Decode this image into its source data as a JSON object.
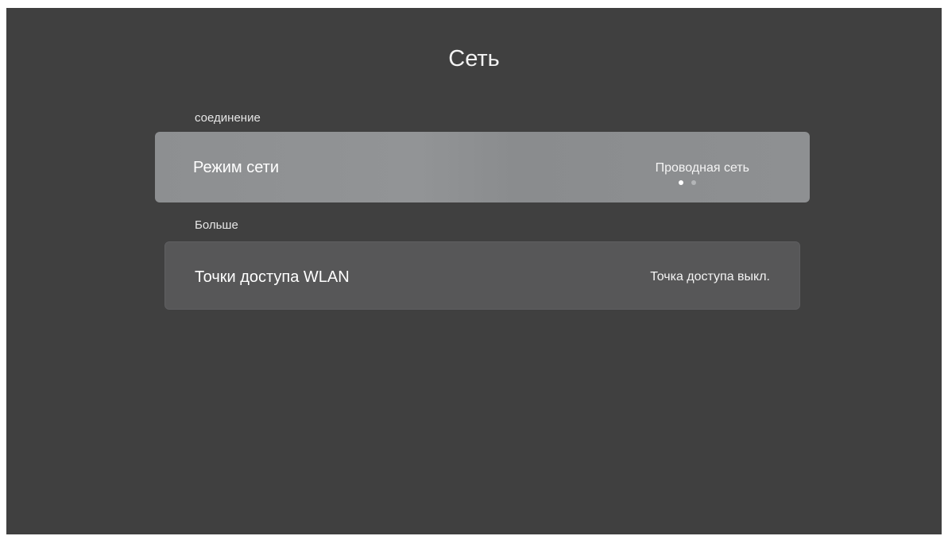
{
  "title": "Сеть",
  "sections": [
    {
      "label": "соединение",
      "items": [
        {
          "label": "Режим сети",
          "value": "Проводная сеть",
          "options_count": 2,
          "selected_index": 0,
          "focused": true
        }
      ]
    },
    {
      "label": "Больше",
      "items": [
        {
          "label": "Точки доступа WLAN",
          "value": "Точка доступа выкл.",
          "focused": false
        }
      ]
    }
  ],
  "colors": {
    "background": "#404040",
    "focused_row": "#8e9092",
    "row": "#575758",
    "text": "#ffffff"
  }
}
